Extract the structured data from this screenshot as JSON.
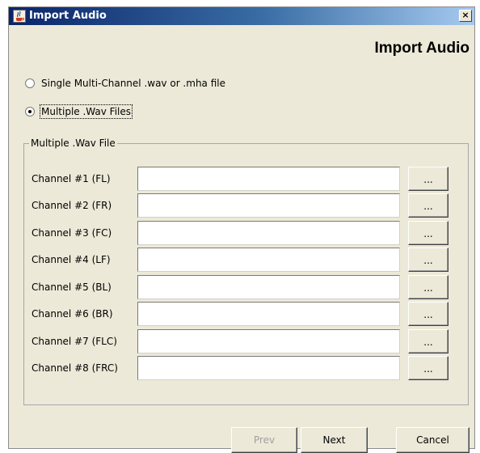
{
  "window": {
    "title": "Import Audio",
    "icon": "java-icon",
    "close_label": "×"
  },
  "heading": "Import Audio",
  "options": [
    {
      "label": "Single Multi-Channel .wav or .mha file",
      "selected": false
    },
    {
      "label": "Multiple .Wav Files",
      "selected": true
    }
  ],
  "group": {
    "title": "Multiple .Wav File",
    "channels": [
      {
        "label": "Channel #1 (FL)",
        "value": "",
        "browse_label": "..."
      },
      {
        "label": "Channel #2 (FR)",
        "value": "",
        "browse_label": "..."
      },
      {
        "label": "Channel #3 (FC)",
        "value": "",
        "browse_label": "..."
      },
      {
        "label": "Channel #4 (LF)",
        "value": "",
        "browse_label": "..."
      },
      {
        "label": "Channel #5 (BL)",
        "value": "",
        "browse_label": "..."
      },
      {
        "label": "Channel #6 (BR)",
        "value": "",
        "browse_label": "..."
      },
      {
        "label": "Channel #7 (FLC)",
        "value": "",
        "browse_label": "..."
      },
      {
        "label": "Channel #8 (FRC)",
        "value": "",
        "browse_label": "..."
      }
    ]
  },
  "buttons": {
    "prev": "Prev",
    "prev_enabled": false,
    "next": "Next",
    "cancel": "Cancel"
  }
}
